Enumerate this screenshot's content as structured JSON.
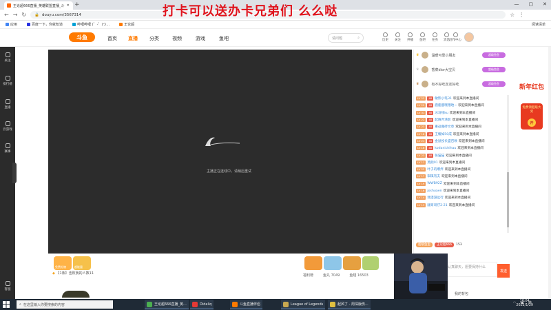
{
  "browser": {
    "tab_title": "王论超666直播_英雄联盟直播_斗",
    "new_tab": "+",
    "window_buttons": [
      "—",
      "▢",
      "✕"
    ],
    "url": "douyu.com/3567314",
    "bookmarks": [
      "应用",
      "百度一下，你就知道",
      "哔哩哔哩 (゜-゜)つ...",
      "王论超"
    ],
    "reading_list": "阅读清单"
  },
  "overlay_caption": "打卡可以送办卡兄弟们 么么哒",
  "site": {
    "logo": "斗鱼",
    "nav": [
      "首页",
      "直播",
      "分类",
      "视频",
      "游戏",
      "鱼吧"
    ],
    "search_placeholder": "请问题",
    "header_icons": [
      {
        "name": "history-icon",
        "label": "历史"
      },
      {
        "name": "follow-icon",
        "label": "关注"
      },
      {
        "name": "live-icon",
        "label": "开播"
      },
      {
        "name": "fishbar-icon",
        "label": "鱼吧"
      },
      {
        "name": "task-icon",
        "label": "任务"
      },
      {
        "name": "message-icon",
        "label": "消息"
      },
      {
        "name": "creator-icon",
        "label": "创作中心"
      }
    ]
  },
  "sidebar": {
    "items": [
      {
        "icon": "heart-icon",
        "label": "关注"
      },
      {
        "icon": "rank-icon",
        "label": "排行榜"
      },
      {
        "icon": "tv-icon",
        "label": "直播"
      },
      {
        "icon": "gamepad-icon",
        "label": "云游戏"
      },
      {
        "icon": "trophy-icon",
        "label": "赛事"
      },
      {
        "icon": "support-icon",
        "label": "客服"
      }
    ]
  },
  "player": {
    "message": "主播正在连线中，请稍后重试"
  },
  "gifts": {
    "left_labels": [
      "免费礼物",
      "超能量"
    ],
    "ticker": "【1条】击败我的人数11",
    "stats": [
      "福利榜",
      "鱼丸 7049",
      "鱼翅 16503"
    ]
  },
  "ranking": [
    {
      "name": "温暖可靠小朋友",
      "badge": "超级鱼鱼"
    },
    {
      "name": "香菜dior大宝贝",
      "badge": "超级鱼鱼"
    },
    {
      "name": "有不好吃定定好吃",
      "badge": "超级鱼鱼"
    }
  ],
  "chat": [
    {
      "lv": "LV 23",
      "fans": "48",
      "user": "敏熊小笔31",
      "msg": "欢迎来到本直播间"
    },
    {
      "lv": "LV 22",
      "fans": "48",
      "user": "鹿鹿鹿哦哦哈~",
      "msg": "欢迎来到本直播间"
    },
    {
      "lv": "LV 31",
      "fans": "48",
      "user": "冰马钱ku",
      "msg": "欢迎来到本直播间"
    },
    {
      "lv": "LV 22",
      "fans": "48",
      "user": "起舞弄清影",
      "msg": "欢迎来到本直播间"
    },
    {
      "lv": "LV 23",
      "fans": "48",
      "user": "重返搬砖文章",
      "msg": "欢迎来到本直播间"
    },
    {
      "lv": "LV 18",
      "fans": "48",
      "user": "王耀如50成",
      "msg": "欢迎来到本直播间"
    },
    {
      "lv": "LV 21",
      "fans": "48",
      "user": "金鼠投长盛召唤",
      "msg": "欢迎来到本直播间"
    },
    {
      "lv": "LV 16",
      "fans": "48",
      "user": "kodanichihau",
      "msg": "欢迎来到本直播间"
    },
    {
      "lv": "LV 23",
      "fans": "48",
      "user": "张猫猫",
      "msg": "欢迎来到本直播间"
    },
    {
      "lv": "LV 11",
      "fans": "",
      "user": "莫颜01",
      "msg": "欢迎来到本直播间"
    },
    {
      "lv": "LV 22",
      "fans": "",
      "user": "叶子的爆炸",
      "msg": "欢迎来到本直播间"
    },
    {
      "lv": "LV 17",
      "fans": "",
      "user": "琪琪有夫",
      "msg": "欢迎来到本直播间"
    },
    {
      "lv": "LV 19",
      "fans": "",
      "user": "WWB92Z",
      "msg": "欢迎来到本直播间"
    },
    {
      "lv": "LV 16",
      "fans": "",
      "user": "joshuaen",
      "msg": "欢迎来到本直播间"
    },
    {
      "lv": "LV 14",
      "fans": "",
      "user": "我漫游远行",
      "msg": "欢迎来到本直播间"
    },
    {
      "lv": "LV 13",
      "fans": "",
      "user": "腿哥哥仔2-21",
      "msg": "欢迎来到本直播间"
    }
  ],
  "chat_footer": [
    "超级鱼鱼",
    "王论超666",
    "153"
  ],
  "chat_input_placeholder": "认真聊天，愿要保持什么",
  "send_label": "发送",
  "bottom_text": "我的背包",
  "promo": {
    "title": "新年红包",
    "sub": "免费领超级大奖",
    "btn": "开"
  },
  "taskbar": {
    "search": "在这里输入你要搜索的内容",
    "apps": [
      "王论超666直播_英...",
      "Didaliq",
      "斗鱼直播伴侣",
      "League of Legends",
      "起风了 - 周深版伤..."
    ],
    "tray": "英",
    "time": "16:04",
    "date": "2022/1/29"
  },
  "colors": {
    "brand": "#ff7a00",
    "caption": "#e0131c",
    "send": "#ff5e2e"
  }
}
